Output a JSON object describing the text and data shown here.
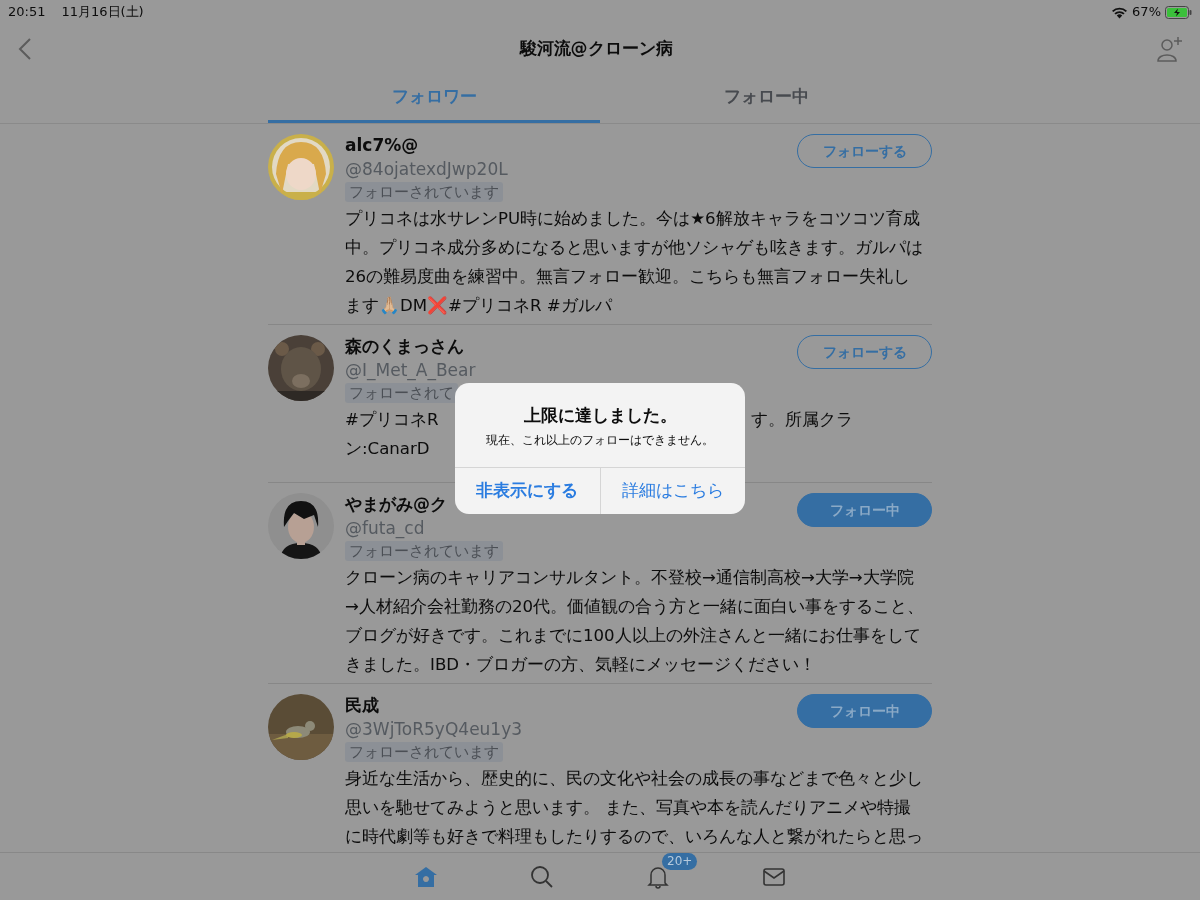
{
  "status_bar": {
    "time": "20:51",
    "date": "11月16日(土)",
    "battery": "67%"
  },
  "header": {
    "title": "駿河流@クローン病"
  },
  "tabs": [
    {
      "label": "フォロワー",
      "selected": true
    },
    {
      "label": "フォロー中",
      "selected": false
    }
  ],
  "users": [
    {
      "name": "alc7%@",
      "handle": "@84ojatexdJwp20L",
      "badge": "フォローされています",
      "bio_lines": [
        [
          "プリコネは水サレンPU時に始めました。今は★6解放キャラをコツコツ育成"
        ],
        [
          "中。プリコネ成分多めになると思いますが他ソシャゲも呟きます。ガルパは"
        ],
        [
          "26の難易度曲を練習中。無言フォロー歓迎。こちらも無言フォロー失礼し"
        ],
        [
          "ます🙏🏼DM❌#プリコネR #ガルパ"
        ]
      ],
      "button": {
        "label": "フォローする",
        "following": false
      }
    },
    {
      "name": "森のくまっさん",
      "handle": "@I_Met_A_Bear",
      "badge": "フォローされて",
      "bio_lines": [
        [
          "#プリコネR",
          "す。所属クラ"
        ],
        [
          "ン:CanarD"
        ]
      ],
      "button": {
        "label": "フォローする",
        "following": false
      }
    },
    {
      "name": "やまがみ@ク",
      "handle": "@futa_cd",
      "badge": "フォローされています",
      "bio_lines": [
        [
          "クローン病のキャリアコンサルタント。不登校→通信制高校→大学→大学院"
        ],
        [
          "→人材紹介会社勤務の20代。価値観の合う方と一緒に面白い事をすること、"
        ],
        [
          "ブログが好きです。これまでに100人以上の外注さんと一緒にお仕事をして"
        ],
        [
          "きました。IBD・ブロガーの方、気軽にメッセージください！"
        ]
      ],
      "button": {
        "label": "フォロー中",
        "following": true
      }
    },
    {
      "name": "民成",
      "handle": "@3WjToR5yQ4eu1y3",
      "badge": "フォローされています",
      "bio_lines": [
        [
          "身近な生活から、歴史的に、民の文化や社会の成長の事などまで色々と少し"
        ],
        [
          "思いを馳せてみようと思います。 また、写真や本を読んだりアニメや特撮"
        ],
        [
          "に時代劇等も好きで料理もしたりするので、いろんな人と繋がれたらと思っ"
        ]
      ],
      "button": {
        "label": "フォロー中",
        "following": true
      }
    }
  ],
  "alert": {
    "title": "上限に達しました。",
    "message": "現在、これ以上のフォローはできません。",
    "buttons": [
      "非表示にする",
      "詳細はこちら"
    ]
  },
  "tab_bar": {
    "notifications_badge": "20+"
  }
}
